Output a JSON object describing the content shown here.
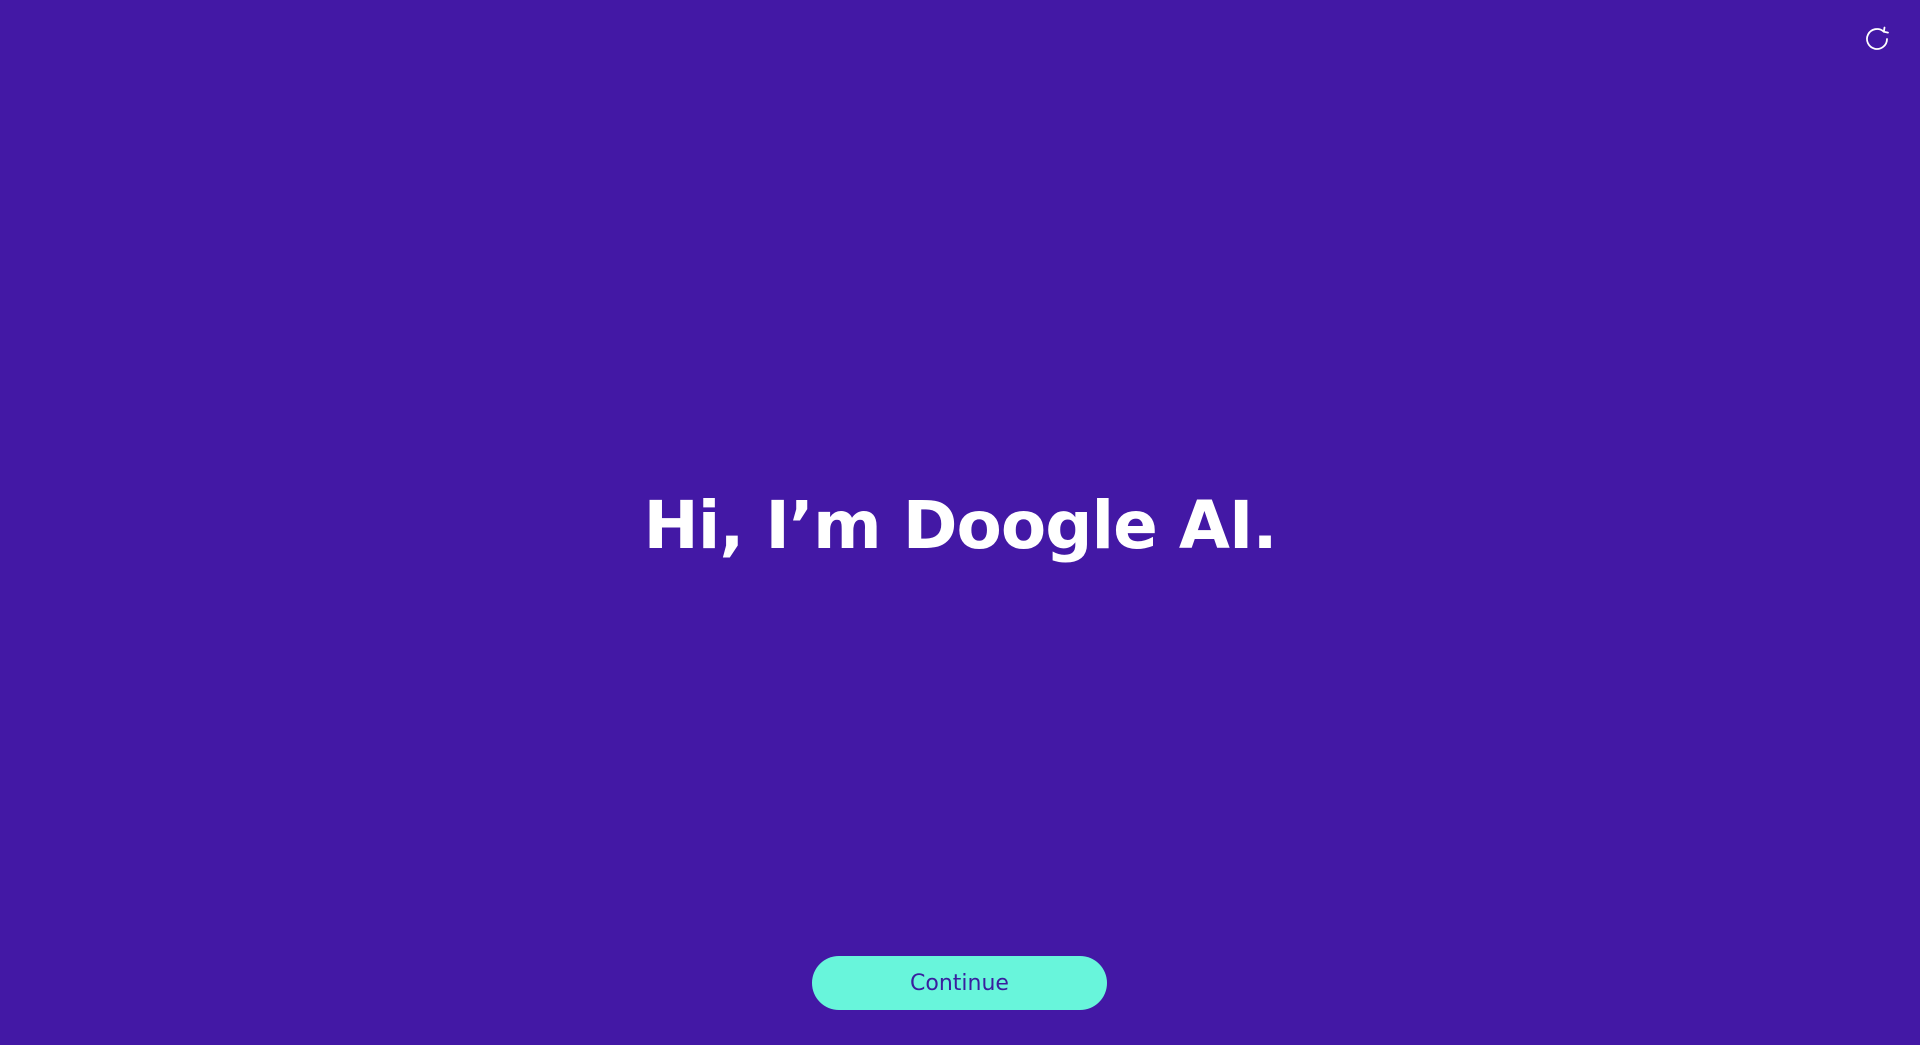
{
  "app": {
    "background_color": "#4318A5"
  },
  "header": {
    "refresh_icon": "refresh-icon"
  },
  "main": {
    "headline": "Hi, I’m Doogle AI."
  },
  "footer": {
    "continue_label": "Continue",
    "continue_color": "#68F5DB",
    "continue_text_color": "#3A1E9E"
  }
}
